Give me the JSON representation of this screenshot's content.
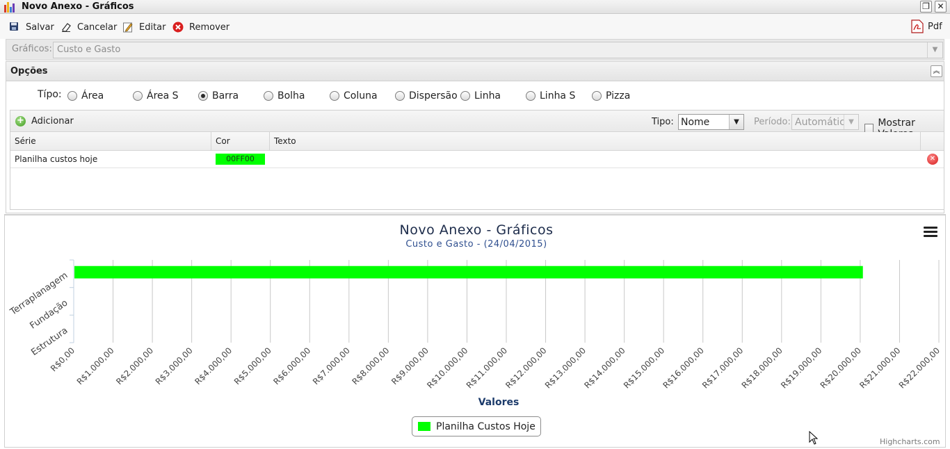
{
  "window": {
    "title": "Novo Anexo - Gráficos"
  },
  "toolbar": {
    "salvar": "Salvar",
    "cancelar": "Cancelar",
    "editar": "Editar",
    "remover": "Remover",
    "pdf": "Pdf"
  },
  "graficos": {
    "label": "Gráficos:",
    "value": "Custo e Gasto"
  },
  "opcoes": {
    "title": "Opções",
    "tipo_label": "Típo:",
    "types": [
      "Área",
      "Área S",
      "Barra",
      "Bolha",
      "Coluna",
      "Dispersão",
      "Linha",
      "Linha S",
      "Pizza"
    ],
    "selected": "Barra"
  },
  "series_grid": {
    "add_label": "Adicionar",
    "tipo_label": "Tipo:",
    "tipo_value": "Nome",
    "periodo_label": "Período:",
    "periodo_value": "Automático",
    "mostrar_label": "Mostrar Valores",
    "columns": [
      "Série",
      "Cor",
      "Texto"
    ],
    "rows": [
      {
        "serie": "Planilha custos hoje",
        "cor": "00FF00",
        "texto": ""
      }
    ]
  },
  "chart_data": {
    "type": "bar",
    "title": "Novo Anexo - Gráficos",
    "subtitle": "Custo e Gasto - (24/04/2015)",
    "categories": [
      "Terraplanagem",
      "Fundação",
      "Estrutura"
    ],
    "series": [
      {
        "name": "Planilha Custos Hoje",
        "color": "#00FF00",
        "values": [
          20050,
          0,
          0
        ]
      }
    ],
    "xlabel": "Valores",
    "value_ticks": [
      "R$0,00",
      "R$1.000,00",
      "R$2.000,00",
      "R$3.000,00",
      "R$4.000,00",
      "R$5.000,00",
      "R$6.000,00",
      "R$7.000,00",
      "R$8.000,00",
      "R$9.000,00",
      "R$10.000,00",
      "R$11.000,00",
      "R$12.000,00",
      "R$13.000,00",
      "R$14.000,00",
      "R$15.000,00",
      "R$16.000,00",
      "R$17.000,00",
      "R$18.000,00",
      "R$19.000,00",
      "R$20.000,00",
      "R$21.000,00",
      "R$22.000,00"
    ],
    "value_range": [
      0,
      22000
    ],
    "grid": true,
    "legend_position": "bottom-center",
    "credits": "Highcharts.com"
  }
}
